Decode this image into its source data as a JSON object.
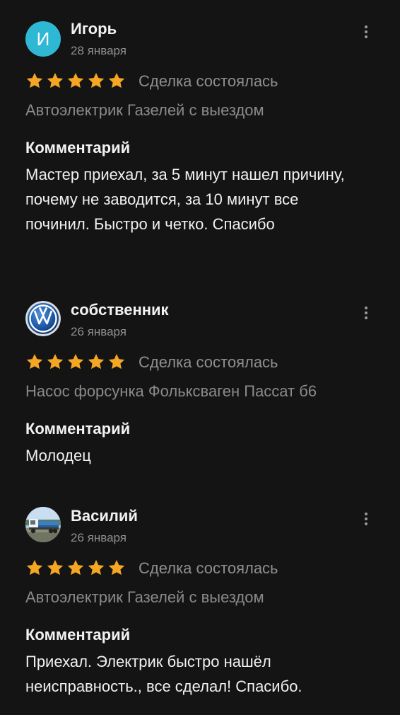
{
  "colors": {
    "background": "#141414",
    "star": "#f5a623",
    "avatar_igor": "#2fb8d4",
    "muted_text": "#8f8f8f"
  },
  "labels": {
    "deal_status": "Сделка состоялась",
    "comment_heading": "Комментарий"
  },
  "reviews": [
    {
      "author": "Игорь",
      "avatar_letter": "И",
      "avatar_type": "letter",
      "date": "28 января",
      "rating": 5,
      "max_rating": 5,
      "deal_status": "Сделка состоялась",
      "service": "Автоэлектрик Газелей с выездом",
      "comment_heading": "Комментарий",
      "comment": "Мастер приехал, за 5 минут нашел причину, почему не заводится, за 10 минут все починил. Быстро и четко. Спасибо",
      "menu_icon": "more-vertical-icon"
    },
    {
      "author": "собственник",
      "avatar_type": "volkswagen-logo",
      "date": "26 января",
      "rating": 5,
      "max_rating": 5,
      "deal_status": "Сделка состоялась",
      "service": "Насос форсунка Фольксваген Пассат б6",
      "comment_heading": "Комментарий",
      "comment": "Молодец",
      "menu_icon": "more-vertical-icon"
    },
    {
      "author": "Василий",
      "avatar_type": "truck-photo",
      "date": "26 января",
      "rating": 5,
      "max_rating": 5,
      "deal_status": "Сделка состоялась",
      "service": "Автоэлектрик Газелей с выездом",
      "comment_heading": "Комментарий",
      "comment": "Приехал. Электрик быстро нашёл неисправность., все сделал! Спасибо.",
      "menu_icon": "more-vertical-icon"
    }
  ]
}
